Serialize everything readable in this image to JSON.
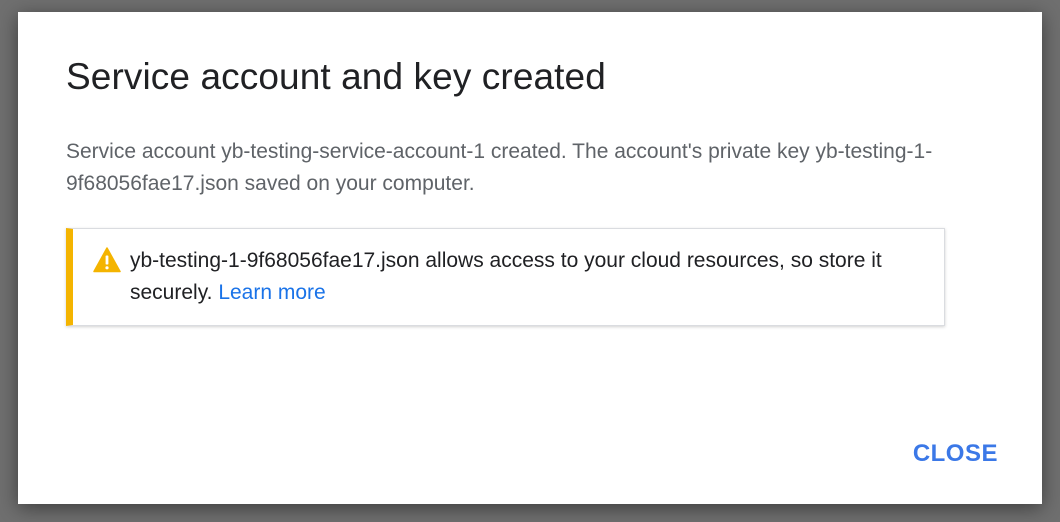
{
  "dialog": {
    "title": "Service account and key created",
    "message": "Service account yb-testing-service-account-1 created. The account's private key yb-testing-1-9f68056fae17.json saved on your computer.",
    "warning": {
      "icon": "warning-icon",
      "text": "yb-testing-1-9f68056fae17.json allows access to your cloud resources, so store it securely.",
      "link_label": "Learn more"
    },
    "close_label": "CLOSE"
  },
  "colors": {
    "accent_blue": "#3b78e7",
    "warning_yellow": "#f4b400"
  }
}
